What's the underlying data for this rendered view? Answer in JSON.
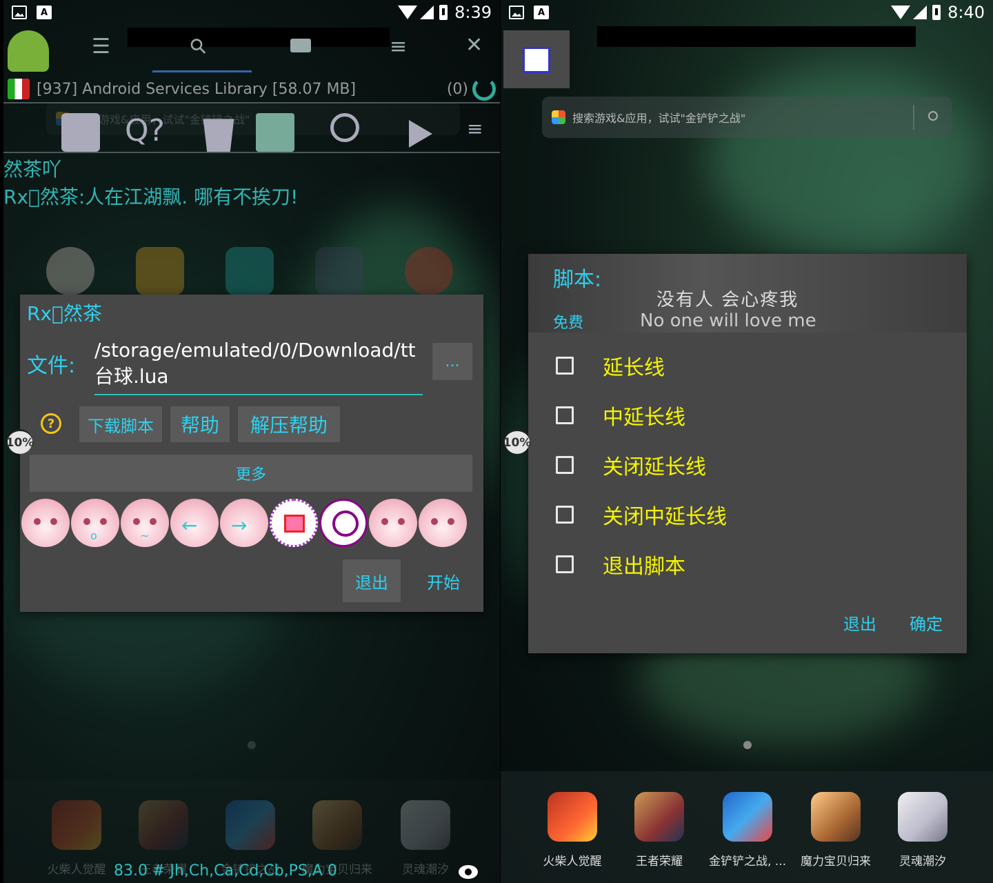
{
  "left": {
    "status": {
      "time": "8:39"
    },
    "gg": {
      "process_label": "[937] Android Services Library [58.07 MB]",
      "count": "(0)"
    },
    "bg_search_placeholder": "搜索游戏&应用，试试\"金铲铲之战\"",
    "overlay_lines": [
      "然茶吖",
      "Rx⃞然茶:人在江湖飘. 哪有不挨刀!"
    ],
    "dialog": {
      "title": "Rx⃞然茶",
      "file_label": "文件:",
      "file_path": "/storage/emulated/0/Download/tt台球.lua",
      "browse_label": "...",
      "help_icon": "?",
      "buttons": [
        "下载脚本",
        "帮助",
        "解压帮助"
      ],
      "more_label": "更多",
      "exit_label": "退出",
      "start_label": "开始"
    },
    "float_badge": "10%",
    "dock": [
      {
        "label": "火柴人觉醒",
        "icon": "stickman-game-icon"
      },
      {
        "label": "王者荣耀",
        "icon": "honor-of-kings-icon"
      },
      {
        "label": "金铲铲之战",
        "icon": "golden-spatula-icon"
      },
      {
        "label": "魔力宝贝归来",
        "icon": "crossgate-icon"
      },
      {
        "label": "灵魂潮汐",
        "icon": "soul-tide-icon"
      }
    ],
    "bottom_status": "83.0 # Jh,Ch,Ca,Cd,Cb,PS,A 0"
  },
  "right": {
    "status": {
      "time": "8:40"
    },
    "search_placeholder": "搜索游戏&应用，试试\"金铲铲之战\"",
    "dialog": {
      "title": "脚本:",
      "subtitle": "免费",
      "banner_cn": "没有人 会心疼我",
      "banner_en": "No one will love me",
      "options": [
        "延长线",
        "中延长线",
        "关闭延长线",
        "关闭中延长线",
        "退出脚本"
      ],
      "exit_label": "退出",
      "ok_label": "确定"
    },
    "float_badge": "10%",
    "dock": [
      {
        "label": "火柴人觉醒",
        "icon": "stickman-game-icon"
      },
      {
        "label": "王者荣耀",
        "icon": "honor-of-kings-icon"
      },
      {
        "label": "金铲铲之战, ...",
        "icon": "golden-spatula-icon"
      },
      {
        "label": "魔力宝贝归来",
        "icon": "crossgate-icon"
      },
      {
        "label": "灵魂潮汐",
        "icon": "soul-tide-icon"
      }
    ]
  }
}
